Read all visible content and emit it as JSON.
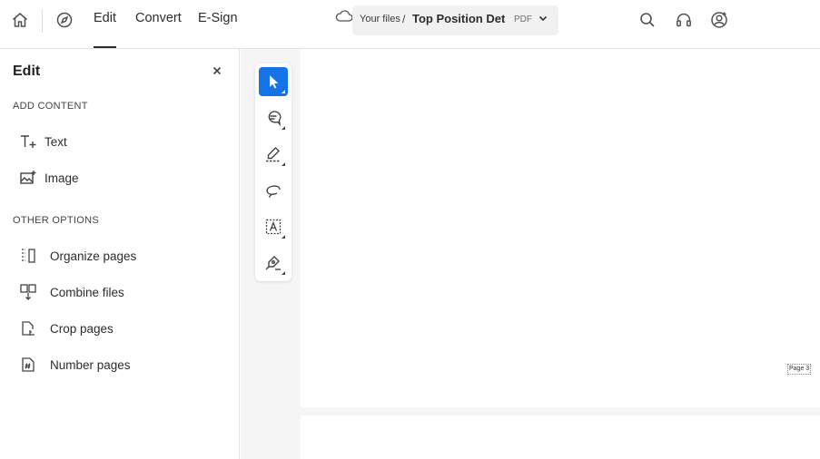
{
  "header": {
    "tabs": [
      {
        "label": "Edit",
        "active": true
      },
      {
        "label": "Convert",
        "active": false
      },
      {
        "label": "E-Sign",
        "active": false
      }
    ],
    "file": {
      "location": "Your files",
      "separator": "/",
      "name": "Top Position Det...",
      "type": "PDF"
    },
    "icons": [
      "home-icon",
      "compass-icon",
      "cloud-icon",
      "chevron-down-icon",
      "search-icon",
      "headset-icon",
      "account-icon"
    ]
  },
  "panel": {
    "title": "Edit",
    "sections": [
      {
        "heading": "ADD CONTENT",
        "items": [
          {
            "label": "Text",
            "icon": "add-text-icon"
          },
          {
            "label": "Image",
            "icon": "add-image-icon"
          }
        ]
      },
      {
        "heading": "OTHER OPTIONS",
        "items": [
          {
            "label": "Organize pages",
            "icon": "organize-pages-icon"
          },
          {
            "label": "Combine files",
            "icon": "combine-files-icon"
          },
          {
            "label": "Crop pages",
            "icon": "crop-pages-icon"
          },
          {
            "label": "Number pages",
            "icon": "number-pages-icon"
          }
        ]
      }
    ]
  },
  "toolbar": {
    "tools": [
      {
        "name": "select-tool",
        "active": true
      },
      {
        "name": "comment-tool",
        "active": false
      },
      {
        "name": "highlight-tool",
        "active": false
      },
      {
        "name": "draw-tool",
        "active": false
      },
      {
        "name": "text-box-tool",
        "active": false
      },
      {
        "name": "sign-tool",
        "active": false
      }
    ]
  },
  "document": {
    "page_label": "Page 3"
  },
  "colors": {
    "accent": "#1473e6",
    "canvas": "#f5f5f5"
  }
}
